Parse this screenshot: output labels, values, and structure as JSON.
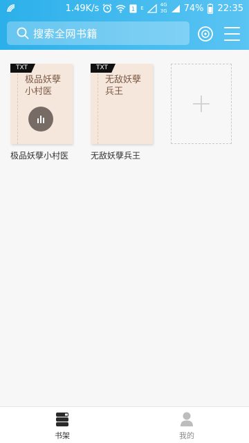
{
  "status_bar": {
    "net_speed": "1.49K/s",
    "net_e": "E",
    "net_4g_a": "4G",
    "net_4g_b": "4G",
    "net_3g": "3G",
    "battery": "74%",
    "time": "22:35",
    "icons": [
      "carrier-icon",
      "alarm-icon",
      "wifi-icon",
      "sim-icon",
      "signal-icon",
      "battery-icon"
    ]
  },
  "header": {
    "search_placeholder": "搜索全网书籍",
    "icons": [
      "search-icon",
      "disc-icon",
      "menu-icon"
    ]
  },
  "bookshelf": {
    "books": [
      {
        "tag": "TXT",
        "cover_title": "极品妖孽小村医",
        "title": "极品妖孽小村医",
        "playing": true
      },
      {
        "tag": "TXT",
        "cover_title": "无敌妖孽兵王",
        "title": "无敌妖孽兵王",
        "playing": false
      }
    ],
    "add_icon": "plus-icon"
  },
  "bottom_nav": {
    "tabs": [
      {
        "label": "书架",
        "icon": "bookshelf-icon",
        "active": true
      },
      {
        "label": "我的",
        "icon": "profile-icon",
        "active": false
      }
    ]
  },
  "colors": {
    "header_start": "#2cb0ea",
    "header_end": "#5ac4f3",
    "cover_bg": "#f6e7dc",
    "cover_text": "#7a5a45"
  }
}
